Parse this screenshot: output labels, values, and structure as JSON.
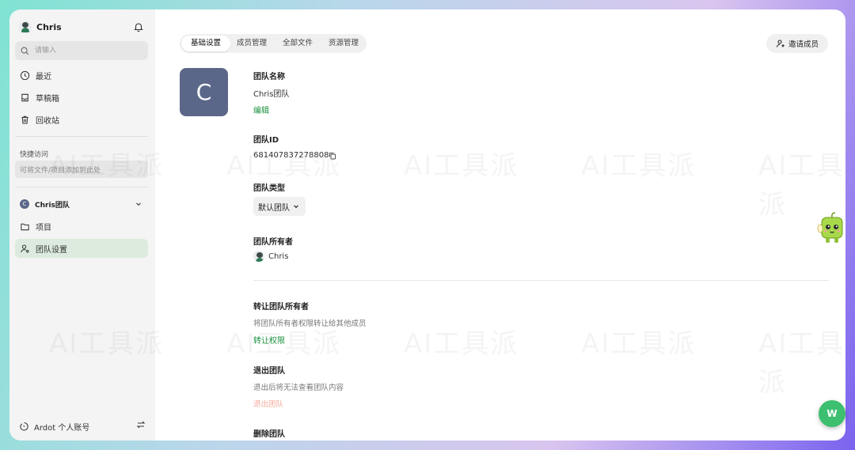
{
  "sidebar": {
    "user_name": "Chris",
    "search_placeholder": "请输入",
    "nav": [
      {
        "label": "最近"
      },
      {
        "label": "草稿箱"
      },
      {
        "label": "回收站"
      }
    ],
    "quick_access": {
      "title": "快捷访问",
      "hint": "可将文件/项目添加到此处"
    },
    "team": {
      "initial": "C",
      "name": "Chris团队"
    },
    "team_nav": [
      {
        "label": "项目"
      },
      {
        "label": "团队设置"
      }
    ],
    "footer_label": "Ardot 个人账号"
  },
  "main": {
    "tabs": [
      {
        "label": "基础设置",
        "active": true
      },
      {
        "label": "成员管理",
        "active": false
      },
      {
        "label": "全部文件",
        "active": false
      },
      {
        "label": "资源管理",
        "active": false
      }
    ],
    "invite_label": "邀请成员",
    "team_avatar_initial": "C",
    "name_section": {
      "title": "团队名称",
      "value": "Chris团队",
      "edit_link": "编辑"
    },
    "id_section": {
      "title": "团队ID",
      "value": "681407837278808"
    },
    "type_section": {
      "title": "团队类型",
      "value": "默认团队"
    },
    "owner_section": {
      "title": "团队所有者",
      "owner_name": "Chris"
    },
    "transfer_section": {
      "title": "转让团队所有者",
      "desc": "将团队所有者权限转让给其他成员",
      "link": "转让权限"
    },
    "leave_section": {
      "title": "退出团队",
      "desc": "退出后将无法查看团队内容",
      "link": "退出团队"
    },
    "delete_section": {
      "title": "删除团队"
    }
  },
  "fab_label": "W",
  "watermark_text": "AI工具派",
  "colors": {
    "accent_green": "#17913c",
    "team_avatar": "#5a6789",
    "active_nav_bg": "#dcebdd",
    "danger_link": "#f3a89a",
    "fab": "#3cbf6f"
  }
}
